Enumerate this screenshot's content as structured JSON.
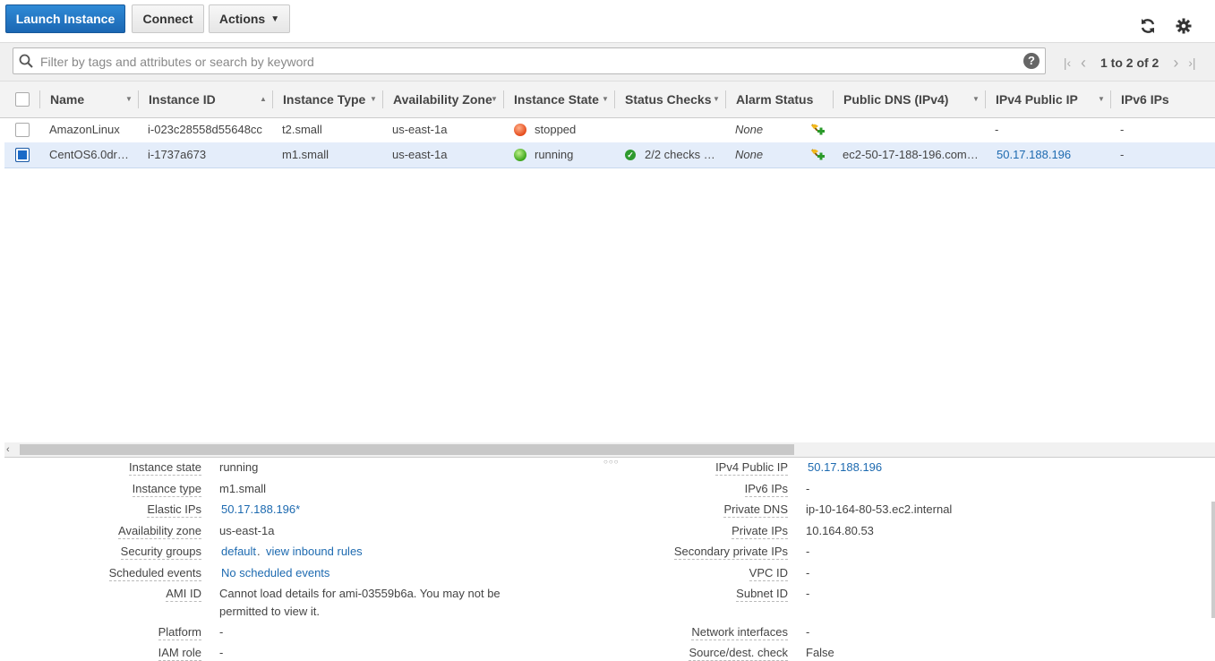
{
  "toolbar": {
    "launch_label": "Launch Instance",
    "connect_label": "Connect",
    "actions_label": "Actions"
  },
  "search": {
    "placeholder": "Filter by tags and attributes or search by keyword"
  },
  "pagination": {
    "text": "1 to 2 of 2"
  },
  "columns": [
    "Name",
    "Instance ID",
    "Instance Type",
    "Availability Zone",
    "Instance State",
    "Status Checks",
    "Alarm Status",
    "Public DNS (IPv4)",
    "IPv4 Public IP",
    "IPv6 IPs"
  ],
  "rows": [
    {
      "selected": false,
      "name": "AmazonLinux",
      "instance_id": "i-023c28558d55648cc",
      "instance_type": "t2.small",
      "az": "us-east-1a",
      "state": "stopped",
      "state_color": "#e54b1c",
      "status_checks": "",
      "alarm": "None",
      "public_dns": "",
      "ipv4": "-",
      "ipv6": "-"
    },
    {
      "selected": true,
      "name": "CentOS6.0dr…",
      "instance_id": "i-1737a673",
      "instance_type": "m1.small",
      "az": "us-east-1a",
      "state": "running",
      "state_color": "#3ca41a",
      "status_checks": "2/2 checks …",
      "alarm": "None",
      "public_dns": "ec2-50-17-188-196.com…",
      "ipv4": "50.17.188.196",
      "ipv6": "-"
    }
  ],
  "details_left": [
    {
      "label": "Instance state",
      "value": "running"
    },
    {
      "label": "Instance type",
      "value": "m1.small"
    },
    {
      "label": "Elastic IPs",
      "value": "50.17.188.196*"
    },
    {
      "label": "Availability zone",
      "value": "us-east-1a"
    },
    {
      "label": "Security groups",
      "value": "default",
      "value2": "view inbound rules"
    },
    {
      "label": "Scheduled events",
      "value": "No scheduled events"
    },
    {
      "label": "AMI ID",
      "value": "Cannot load details for ami-03559b6a. You may not be",
      "value2": "permitted to view it."
    },
    {
      "label": "Platform",
      "value": "-"
    },
    {
      "label": "IAM role",
      "value": "-"
    }
  ],
  "details_right": [
    {
      "label": "IPv4 Public IP",
      "value": "50.17.188.196"
    },
    {
      "label": "IPv6 IPs",
      "value": "-"
    },
    {
      "label": "Private DNS",
      "value": "ip-10-164-80-53.ec2.internal"
    },
    {
      "label": "Private IPs",
      "value": "10.164.80.53"
    },
    {
      "label": "Secondary private IPs",
      "value": "-"
    },
    {
      "label": "VPC ID",
      "value": "-"
    },
    {
      "label": "Subnet ID",
      "value": "-"
    },
    {
      "label": "Network interfaces",
      "value": "-"
    },
    {
      "label": "Source/dest. check",
      "value": "False"
    }
  ],
  "icons": [
    "search-icon",
    "help-icon",
    "refresh-icon",
    "gear-icon",
    "first-page-icon",
    "prev-page-icon",
    "next-page-icon",
    "last-page-icon",
    "alarm-add-icon",
    "status-ok-icon"
  ]
}
